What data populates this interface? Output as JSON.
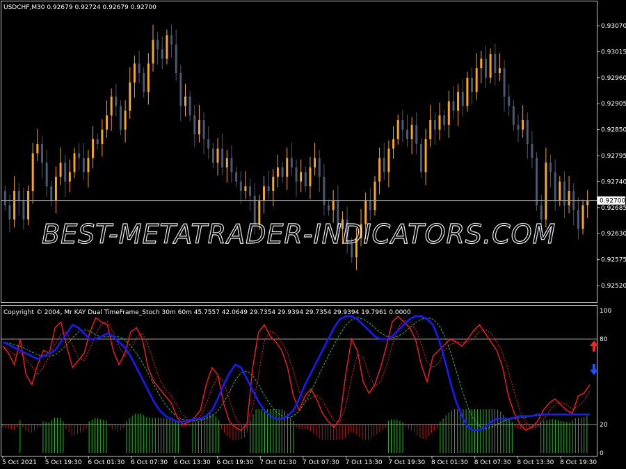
{
  "window": {
    "symbol_header": "USDCHF,M30  0.92679 0.92724 0.92679 0.92700",
    "indicator_header": "Copyright © 2004, Mr KAY Dual TimeFrame_Stoch 30m 60m  45.7557 42.0649 29.7354 29.9394 29.7354 29.9394 19.7961 0.0000",
    "watermark": "BEST-METATRADER-INDICATORS.COM"
  },
  "colors": {
    "background": "#000000",
    "bull_candle": "#f5a623",
    "bear_candle": "#4a5a6e",
    "frame": "#c8c8c8",
    "stoch_fast": "#ff1a1a",
    "stoch_slow": "#1a1aff",
    "signal": "#20c060",
    "hist_up": "#1fbf1f",
    "hist_down": "#c01818",
    "arrow_up": "#ff2020",
    "arrow_down": "#2050ff"
  },
  "price_axis": {
    "ticks": [
      "0.93070",
      "0.93015",
      "0.92960",
      "0.92905",
      "0.92850",
      "0.92795",
      "0.92740",
      "0.92685",
      "0.92630",
      "0.92575",
      "0.92520"
    ],
    "current_price": "0.92700"
  },
  "indicator_axis": {
    "ticks": [
      "100",
      "80",
      "20",
      "0"
    ]
  },
  "time_axis": {
    "ticks": [
      "5 Oct 2021",
      "5 Oct 19:30",
      "6 Oct 01:30",
      "6 Oct 07:30",
      "6 Oct 13:30",
      "6 Oct 19:30",
      "7 Oct 01:30",
      "7 Oct 07:30",
      "7 Oct 13:30",
      "7 Oct 19:30",
      "8 Oct 01:30",
      "8 Oct 07:30",
      "8 Oct 13:30",
      "8 Oct 19:30"
    ]
  },
  "chart_data": {
    "type": "candlestick",
    "price_range": [
      0.92495,
      0.93095
    ],
    "stoch_range": [
      0,
      100
    ],
    "levels": [
      80,
      20
    ],
    "closes": [
      0.9269,
      0.9266,
      0.9272,
      0.927,
      0.9266,
      0.9272,
      0.928,
      0.9282,
      0.9278,
      0.9273,
      0.927,
      0.9275,
      0.9278,
      0.9274,
      0.9276,
      0.928,
      0.9279,
      0.9276,
      0.9279,
      0.9283,
      0.9282,
      0.9285,
      0.9288,
      0.9292,
      0.929,
      0.9285,
      0.9289,
      0.9295,
      0.9299,
      0.9297,
      0.9293,
      0.9299,
      0.9304,
      0.9302,
      0.93,
      0.9305,
      0.9303,
      0.9297,
      0.929,
      0.9292,
      0.9288,
      0.9284,
      0.9287,
      0.9283,
      0.9281,
      0.9278,
      0.9281,
      0.9277,
      0.9279,
      0.9276,
      0.9274,
      0.9272,
      0.9273,
      0.9271,
      0.9265,
      0.927,
      0.9273,
      0.9272,
      0.9275,
      0.9277,
      0.9275,
      0.9279,
      0.9277,
      0.9274,
      0.9276,
      0.9273,
      0.9277,
      0.9279,
      0.9275,
      0.9269,
      0.9268,
      0.927,
      0.9264,
      0.9266,
      0.9261,
      0.9258,
      0.9262,
      0.9265,
      0.927,
      0.9268,
      0.9274,
      0.9279,
      0.9276,
      0.9281,
      0.9283,
      0.9287,
      0.9285,
      0.9283,
      0.9286,
      0.9282,
      0.9276,
      0.9283,
      0.9287,
      0.9285,
      0.9288,
      0.9286,
      0.9291,
      0.9289,
      0.9293,
      0.929,
      0.9296,
      0.9293,
      0.9298,
      0.93,
      0.9296,
      0.9301,
      0.9297,
      0.9298,
      0.9292,
      0.929,
      0.9286,
      0.9285,
      0.9287,
      0.9282,
      0.9279,
      0.9269,
      0.9266,
      0.9278,
      0.9276,
      0.927,
      0.9274,
      0.9269,
      0.9272,
      0.9268,
      0.9264,
      0.9269,
      0.927
    ],
    "stoch_fast": [
      75,
      70,
      62,
      80,
      55,
      48,
      62,
      72,
      70,
      88,
      92,
      75,
      60,
      65,
      70,
      85,
      95,
      92,
      90,
      72,
      62,
      70,
      85,
      88,
      80,
      60,
      50,
      45,
      40,
      35,
      25,
      20,
      22,
      25,
      30,
      48,
      60,
      55,
      35,
      22,
      18,
      16,
      20,
      60,
      85,
      90,
      82,
      78,
      72,
      60,
      40,
      30,
      40,
      45,
      38,
      28,
      22,
      18,
      24,
      55,
      80,
      72,
      50,
      42,
      48,
      60,
      75,
      92,
      96,
      92,
      88,
      80,
      62,
      50,
      68,
      72,
      76,
      80,
      78,
      75,
      80,
      86,
      90,
      84,
      78,
      72,
      60,
      40,
      28,
      20,
      16,
      18,
      22,
      30,
      35,
      38,
      34,
      30,
      28,
      40,
      42,
      48
    ],
    "stoch_slow": [
      78,
      76,
      74,
      72,
      70,
      68,
      66,
      68,
      70,
      72,
      78,
      84,
      90,
      88,
      84,
      80,
      80,
      82,
      84,
      82,
      78,
      74,
      68,
      60,
      52,
      44,
      36,
      30,
      26,
      24,
      22,
      22,
      23,
      24,
      24,
      26,
      30,
      38,
      48,
      56,
      62,
      60,
      52,
      44,
      36,
      30,
      26,
      24,
      24,
      26,
      30,
      38,
      48,
      56,
      64,
      72,
      80,
      88,
      94,
      96,
      96,
      94,
      90,
      86,
      82,
      80,
      80,
      82,
      86,
      90,
      94,
      96,
      96,
      94,
      90,
      80,
      66,
      50,
      36,
      26,
      18,
      16,
      16,
      18,
      22,
      24,
      24,
      24,
      25,
      26,
      26,
      26,
      27,
      27,
      27,
      27,
      27,
      27,
      27,
      27,
      27,
      27
    ]
  }
}
